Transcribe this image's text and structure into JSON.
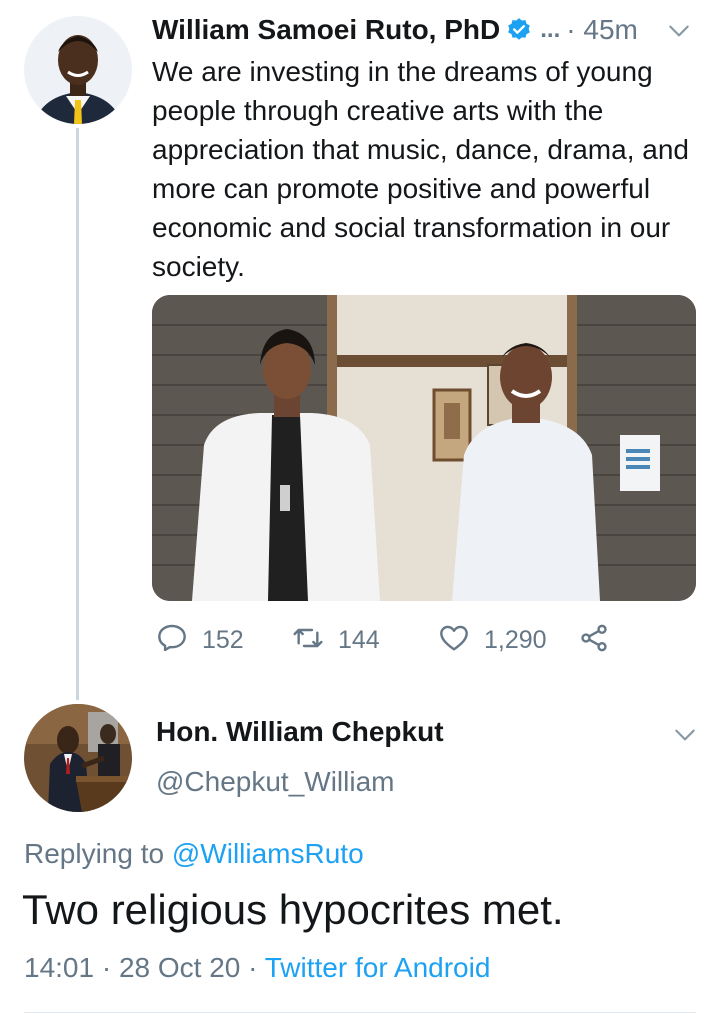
{
  "tweet1": {
    "author_name": "William Samoei Ruto, PhD",
    "verified_icon": "verified-badge-icon",
    "ellipsis": "...",
    "time_ago": "· 45m",
    "text": "We are investing in the dreams of young people through creative arts with the appreciation that music, dance, drama, and more can promote positive and powerful economic and social transformation in our society.",
    "actions": {
      "reply_count": "152",
      "retweet_count": "144",
      "like_count": "1,290"
    }
  },
  "tweet2": {
    "author_name": "Hon. William Chepkut",
    "handle": "@Chepkut_William",
    "replying_label": "Replying to",
    "replying_to": "@WilliamsRuto",
    "text": "Two religious hypocrites met.",
    "timestamp": "14:01 · 28 Oct 20 ·",
    "source": "Twitter for Android"
  },
  "colors": {
    "primary_text": "#14171a",
    "secondary_text": "#657786",
    "link_blue": "#1da1f2",
    "thread_line": "#ccd6dd"
  }
}
